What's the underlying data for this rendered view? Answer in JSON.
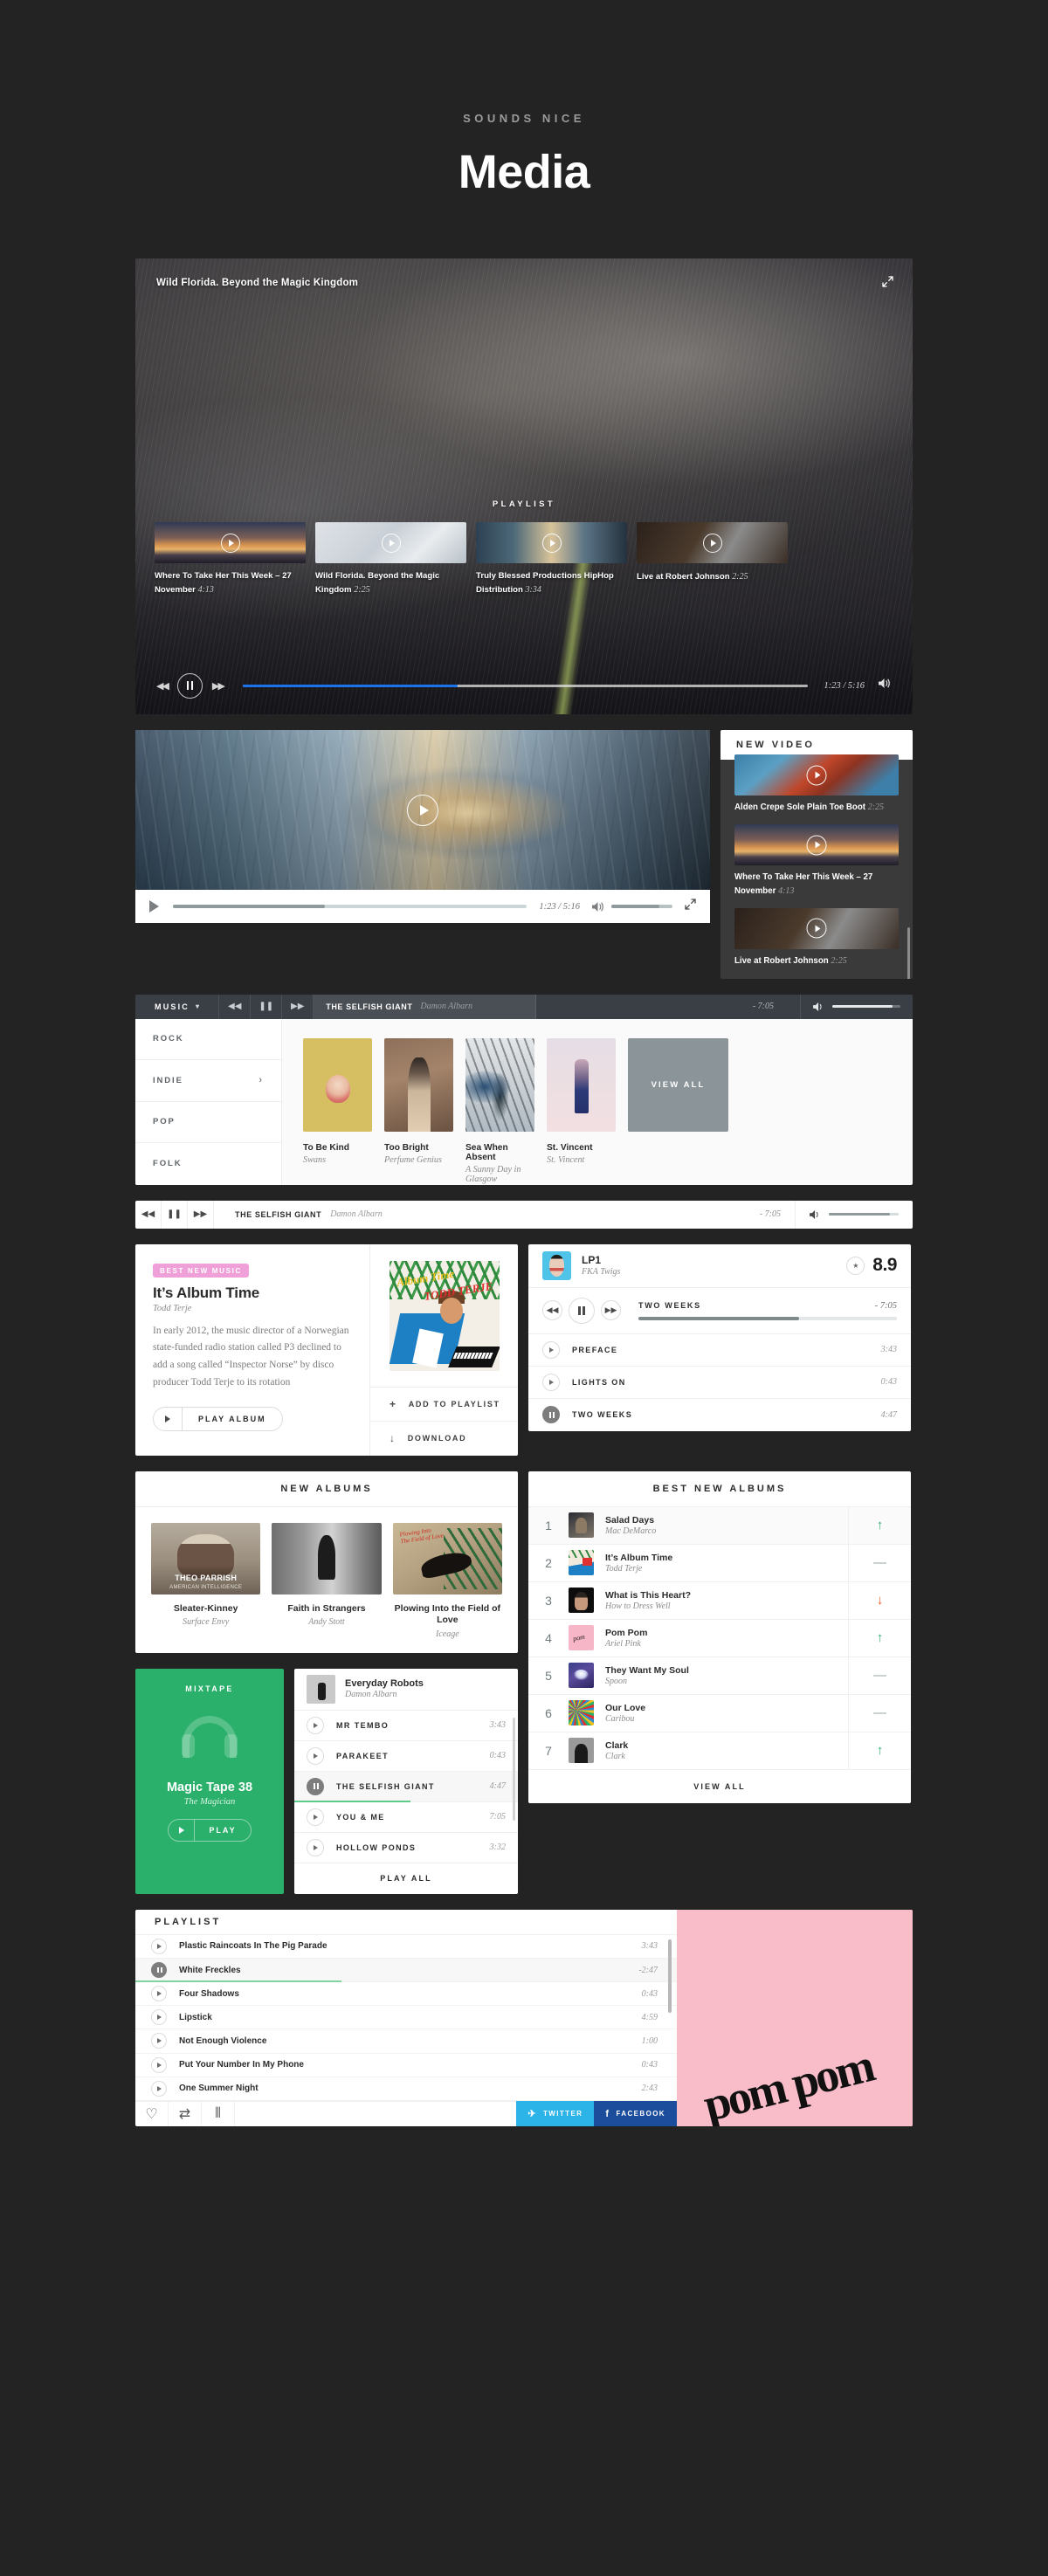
{
  "header": {
    "kicker": "SOUNDS NICE",
    "title": "Media"
  },
  "video_player": {
    "title": "Wild Florida. Beyond the Magic Kingdom",
    "playlist_label": "PLAYLIST",
    "expand_icon": "expand-icon",
    "items": [
      {
        "title": "Where To Take Her This Week – 27 November",
        "duration": "4:13"
      },
      {
        "title": "Wild Florida. Beyond the Magic Kingdom",
        "duration": "2:25"
      },
      {
        "title": "Truly Blessed Productions HipHop Distribution",
        "duration": "3:34"
      },
      {
        "title": "Live at Robert Johnson",
        "duration": "2:25"
      }
    ],
    "controls": {
      "prev": "prev-icon",
      "pause": "pause-icon",
      "next": "next-icon",
      "time": "1:23 / 5:16",
      "progress_pct": 38,
      "volume_icon": "volume-icon"
    }
  },
  "video2": {
    "play_icon": "play-icon",
    "time": "1:23 / 5:16",
    "progress_pct": 43,
    "volume_pct": 78,
    "expand_icon": "expand-icon"
  },
  "new_video": {
    "heading": "NEW VIDEO",
    "items": [
      {
        "title": "Alden Crepe Sole Plain Toe Boot",
        "duration": "2:25"
      },
      {
        "title": "Where To Take Her This Week – 27 November",
        "duration": "4:13"
      },
      {
        "title": "Live at Robert Johnson",
        "duration": "2:25"
      }
    ]
  },
  "music_bar": {
    "menu_label": "MUSIC",
    "chevron": "chevron-down-icon",
    "track_title": "THE SELFISH GIANT",
    "track_artist": "Damon Albarn",
    "remaining": "- 7:05",
    "volume_pct": 88
  },
  "genres": [
    {
      "label": "ROCK",
      "chevron": false
    },
    {
      "label": "INDIE",
      "chevron": true
    },
    {
      "label": "POP",
      "chevron": false
    },
    {
      "label": "FOLK",
      "chevron": false
    }
  ],
  "albums_row": {
    "view_all": "VIEW ALL",
    "items": [
      {
        "title": "To Be Kind",
        "artist": "Swans",
        "art": "art-tobekind"
      },
      {
        "title": "Too Bright",
        "artist": "Perfume Genius",
        "art": "art-toobright"
      },
      {
        "title": "Sea When Absent",
        "artist": "A Sunny Day in Glasgow",
        "art": "art-sea"
      },
      {
        "title": "St. Vincent",
        "artist": "St. Vincent",
        "art": "art-stv"
      }
    ]
  },
  "white_bar": {
    "track_title": "THE SELFISH GIANT",
    "track_artist": "Damon Albarn",
    "remaining": "- 7:05",
    "volume_pct": 88
  },
  "album_time": {
    "badge": "BEST NEW MUSIC",
    "title": "It’s Album Time",
    "artist": "Todd Terje",
    "description": "In early 2012, the music director of a Norwegian state-funded radio station called P3 declined to add a song called “Inspector Norse” by disco producer Todd Terje to its rotation",
    "play_label": "PLAY ALBUM",
    "cover_title_1": "Album Time",
    "cover_title_2": "TODD TERJE",
    "actions": [
      {
        "icon": "plus-icon",
        "glyph": "+",
        "label": "ADD TO PLAYLIST"
      },
      {
        "icon": "download-icon",
        "glyph": "↓",
        "label": "DOWNLOAD"
      }
    ]
  },
  "lp1": {
    "title": "LP1",
    "artist": "FKA Twigs",
    "star_icon": "star-icon",
    "score": "8.9",
    "now_playing": "TWO WEEKS",
    "remaining": "- 7:05",
    "progress_pct": 62,
    "tracks": [
      {
        "name": "PREFACE",
        "duration": "3:43",
        "active": false
      },
      {
        "name": "LIGHTS ON",
        "duration": "0:43",
        "active": false
      },
      {
        "name": "TWO WEEKS",
        "duration": "4:47",
        "active": true
      }
    ]
  },
  "new_albums": {
    "heading": "NEW ALBUMS",
    "items": [
      {
        "title": "Sleater-Kinney",
        "artist": "Surface Envy",
        "art": "art-theo",
        "cap1": "THEO PARRISH",
        "cap2": "AMERICAN INTELLIGENCE"
      },
      {
        "title": "Faith in Strangers",
        "artist": "Andy Stott",
        "art": "art-faith",
        "cap1": "",
        "cap2": ""
      },
      {
        "title": "Plowing Into the Field of Love",
        "artist": "Iceage",
        "art": "art-plow",
        "cap1": "",
        "cap2": ""
      }
    ]
  },
  "best_new_albums": {
    "heading": "BEST NEW ALBUMS",
    "view_all": "VIEW ALL",
    "rows": [
      {
        "rank": "1",
        "title": "Salad Days",
        "artist": "Mac DeMarco",
        "trend": "up",
        "art": "a-salad"
      },
      {
        "rank": "2",
        "title": "It’s Album Time",
        "artist": "Todd Terje",
        "trend": "flat",
        "art": "a-album"
      },
      {
        "rank": "3",
        "title": "What is This Heart?",
        "artist": "How to Dress Well",
        "trend": "down",
        "art": "a-heart"
      },
      {
        "rank": "4",
        "title": "Pom Pom",
        "artist": "Ariel Pink",
        "trend": "up",
        "art": "a-pom"
      },
      {
        "rank": "5",
        "title": "They Want My Soul",
        "artist": "Spoon",
        "trend": "flat",
        "art": "a-soul"
      },
      {
        "rank": "6",
        "title": "Our Love",
        "artist": "Caribou",
        "trend": "flat",
        "art": "a-love"
      },
      {
        "rank": "7",
        "title": "Clark",
        "artist": "Clark",
        "trend": "up",
        "art": "a-clark"
      }
    ]
  },
  "mixtape": {
    "label": "MIXTAPE",
    "title": "Magic Tape 38",
    "artist": "The Magician",
    "play_label": "PLAY",
    "icon": "headphones-icon"
  },
  "everyday_robots": {
    "title": "Everyday Robots",
    "artist": "Damon Albarn",
    "play_all": "PLAY ALL",
    "tracks": [
      {
        "name": "MR TEMBO",
        "duration": "3:43",
        "active": false
      },
      {
        "name": "PARAKEET",
        "duration": "0:43",
        "active": false
      },
      {
        "name": "THE SELFISH GIANT",
        "duration": "4:47",
        "active": true
      },
      {
        "name": "YOU & ME",
        "duration": "7:05",
        "active": false
      },
      {
        "name": "HOLLOW PONDS",
        "duration": "3:32",
        "active": false
      }
    ]
  },
  "final_playlist": {
    "heading": "PLAYLIST",
    "cover_logo": "pom pom",
    "tracks": [
      {
        "name": "Plastic Raincoats In The Pig Parade",
        "duration": "3:43",
        "active": false
      },
      {
        "name": "White Freckles",
        "duration": "-2:47",
        "active": true
      },
      {
        "name": "Four Shadows",
        "duration": "0:43",
        "active": false
      },
      {
        "name": "Lipstick",
        "duration": "4:59",
        "active": false
      },
      {
        "name": "Not Enough Violence",
        "duration": "1:00",
        "active": false
      },
      {
        "name": "Put Your Number In My Phone",
        "duration": "0:43",
        "active": false
      },
      {
        "name": "One Summer Night",
        "duration": "2:43",
        "active": false
      }
    ],
    "footer_icons": [
      {
        "name": "heart-icon",
        "glyph": "♡"
      },
      {
        "name": "repeat-icon",
        "glyph": "⇄"
      },
      {
        "name": "equalizer-icon",
        "glyph": "⦀"
      }
    ],
    "social": [
      {
        "name": "twitter-button",
        "glyph": "✉",
        "label": "TWITTER",
        "color": "#2cb3e8"
      },
      {
        "name": "facebook-button",
        "glyph": "f",
        "label": "FACEBOOK",
        "color": "#1b4d9c"
      }
    ]
  },
  "colors": {
    "page_bg": "#232323",
    "accent_blue": "#1a73e8",
    "accent_green": "#2ab06a",
    "accent_pink": "#efa0d8",
    "cover_pink": "#f9bdca",
    "trend_up": "#2fae6e",
    "trend_down": "#f05423"
  }
}
